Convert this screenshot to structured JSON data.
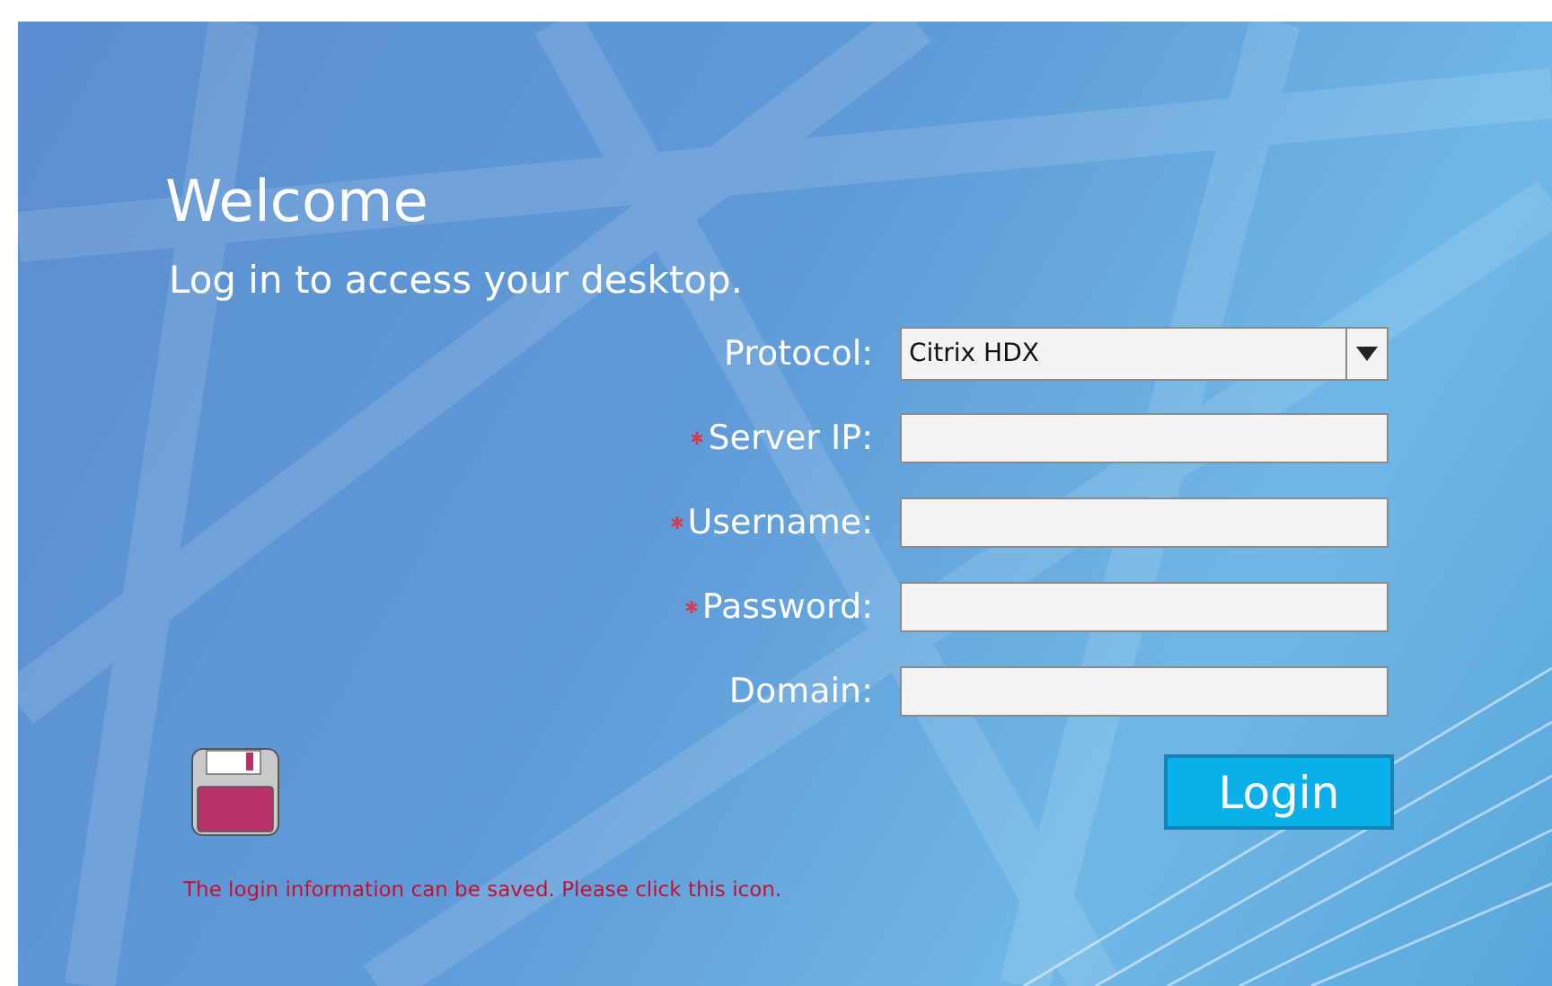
{
  "title": "Welcome",
  "subtitle": "Log in to access your desktop.",
  "fields": [
    {
      "kind": "select",
      "label": "Protocol:",
      "required": false,
      "value": "Citrix HDX"
    },
    {
      "kind": "text",
      "label": "Server IP:",
      "required": true
    },
    {
      "kind": "text",
      "label": "Username:",
      "required": true
    },
    {
      "kind": "password",
      "label": "Password:",
      "required": true
    },
    {
      "kind": "text",
      "label": "Domain:",
      "required": false
    }
  ],
  "login_button": "Login",
  "save_hint": "The login information can be saved. Please click this icon."
}
